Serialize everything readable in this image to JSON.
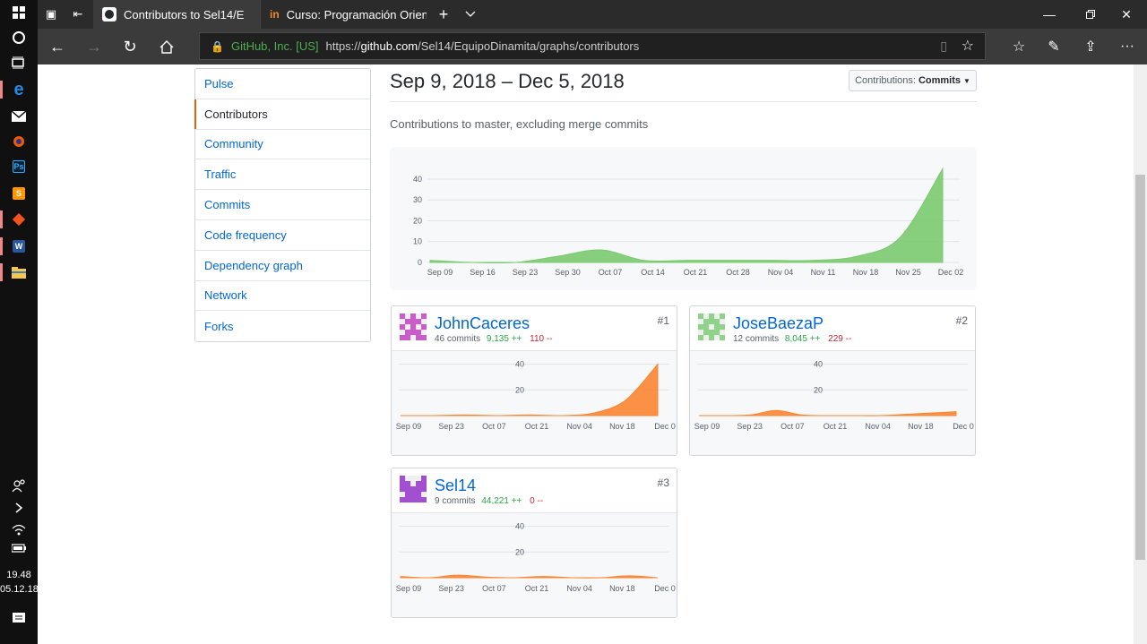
{
  "browser": {
    "tabs": [
      {
        "label": "Contributors to Sel14/E",
        "favicon": "github-icon"
      },
      {
        "label": "Curso: Programación Orient",
        "favicon": "platzi-icon"
      }
    ],
    "address": {
      "org": "GitHub, Inc. [US]",
      "url_prefix": "https://",
      "url_host": "github.com",
      "url_path": "/Sel14/EquipoDinamita/graphs/contributors"
    }
  },
  "taskbar": {
    "time": "19.48",
    "date": "05.12.18"
  },
  "sidebar": {
    "items": [
      {
        "label": "Pulse"
      },
      {
        "label": "Contributors",
        "selected": true
      },
      {
        "label": "Community"
      },
      {
        "label": "Traffic"
      },
      {
        "label": "Commits"
      },
      {
        "label": "Code frequency"
      },
      {
        "label": "Dependency graph"
      },
      {
        "label": "Network"
      },
      {
        "label": "Forks"
      }
    ]
  },
  "header": {
    "date_range": "Sep 9, 2018 – Dec 5, 2018",
    "contributions_prefix": "Contributions:",
    "contributions_value": "Commits",
    "subtitle": "Contributions to master, excluding merge commits"
  },
  "chart_data": [
    {
      "type": "area",
      "name": "main",
      "color": "#7bc96f",
      "x": [
        "Sep 09",
        "Sep 16",
        "Sep 23",
        "Sep 30",
        "Oct 07",
        "Oct 14",
        "Oct 21",
        "Oct 28",
        "Nov 04",
        "Nov 11",
        "Nov 18",
        "Nov 25",
        "Dec 02"
      ],
      "values": [
        1,
        0,
        0,
        3,
        6,
        1,
        1,
        1,
        1,
        1,
        3,
        12,
        45
      ],
      "yticks": [
        0,
        10,
        20,
        30,
        40
      ],
      "ylim": [
        0,
        46
      ]
    },
    {
      "type": "area",
      "name": "JohnCaceres",
      "color": "#fb8532",
      "x": [
        "Sep 09",
        "Sep 23",
        "Oct 07",
        "Oct 21",
        "Nov 04",
        "Nov 18",
        "Dec 0"
      ],
      "values": [
        0,
        0,
        0.5,
        0,
        0.5,
        0,
        2,
        12,
        40
      ],
      "yticks": [
        20,
        40
      ],
      "ylim": [
        0,
        46
      ]
    },
    {
      "type": "area",
      "name": "JoseBaezaP",
      "color": "#fb8532",
      "x": [
        "Sep 09",
        "Sep 23",
        "Oct 07",
        "Oct 21",
        "Nov 04",
        "Nov 18",
        "Dec 0"
      ],
      "values": [
        0,
        0,
        0.5,
        4,
        0.5,
        0,
        0,
        0,
        1,
        2,
        3
      ],
      "yticks": [
        20,
        40
      ],
      "ylim": [
        0,
        46
      ]
    },
    {
      "type": "area",
      "name": "Sel14",
      "color": "#fb8532",
      "x": [
        "Sep 09",
        "Sep 23",
        "Oct 07",
        "Oct 21",
        "Nov 04",
        "Nov 18",
        "Dec 0"
      ],
      "values": [
        1,
        0,
        2,
        0.5,
        0,
        1,
        0,
        0,
        1.5,
        0
      ],
      "yticks": [
        20,
        40
      ],
      "ylim": [
        0,
        46
      ]
    }
  ],
  "contributors": [
    {
      "name": "JohnCaceres",
      "rank": "#1",
      "commits": "46 commits",
      "additions": "9,135 ++",
      "deletions": "110 --",
      "avatar_color": "#c85dc8"
    },
    {
      "name": "JoseBaezaP",
      "rank": "#2",
      "commits": "12 commits",
      "additions": "8,045 ++",
      "deletions": "229 --",
      "avatar_color": "#8fd28a"
    },
    {
      "name": "Sel14",
      "rank": "#3",
      "commits": "9 commits",
      "additions": "44,221 ++",
      "deletions": "0 --",
      "avatar_color": "#a24fd1"
    }
  ]
}
